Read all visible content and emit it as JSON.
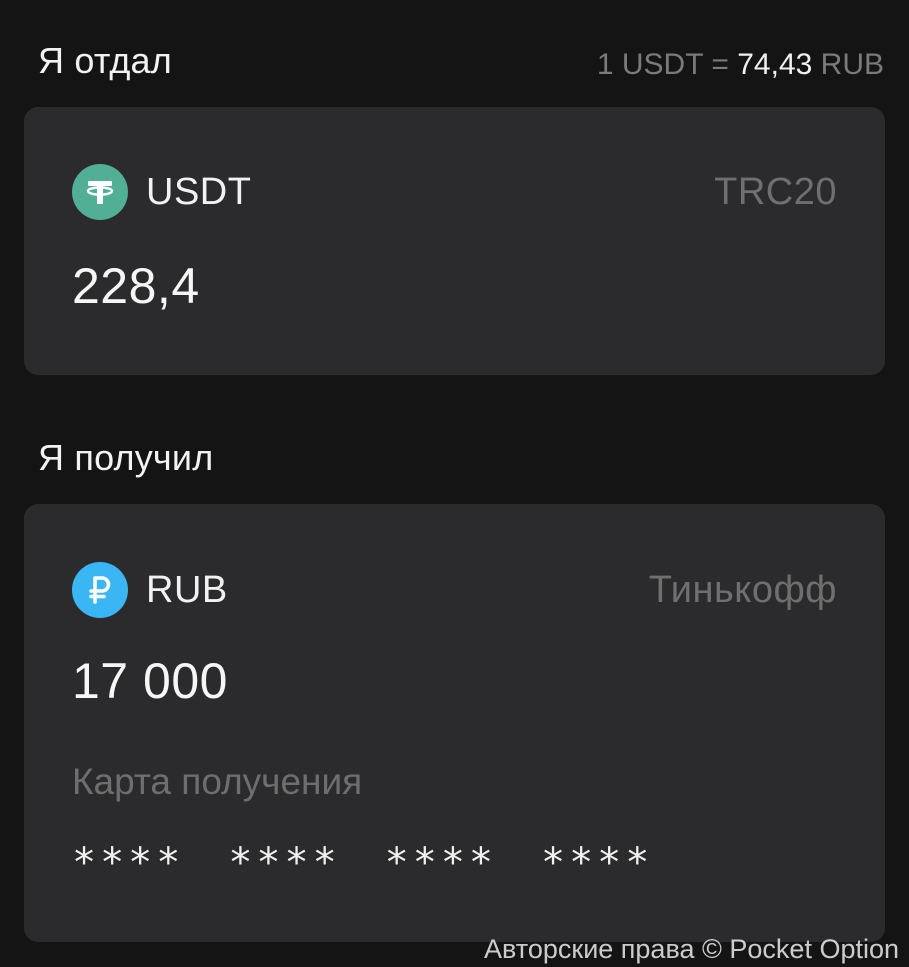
{
  "sent": {
    "title": "Я отдал",
    "rate": {
      "left": "1 USDT",
      "equals": "=",
      "value": "74,43",
      "unit": "RUB"
    },
    "asset": {
      "code": "USDT",
      "network": "TRC20",
      "icon": "tether-icon",
      "icon_color": "#50AF95"
    },
    "amount": "228,4"
  },
  "received": {
    "title": "Я получил",
    "asset": {
      "code": "RUB",
      "network": "Тинькофф",
      "icon": "ruble-icon",
      "icon_color": "#3BB6F5"
    },
    "amount": "17 000",
    "card_label": "Карта получения",
    "card_groups": [
      "****",
      "****",
      "****",
      "****"
    ]
  },
  "watermark": "Авторские права © Pocket Option",
  "colors": {
    "background": "#141414",
    "card": "#2b2b2d",
    "muted_text": "#6f6f6f"
  }
}
